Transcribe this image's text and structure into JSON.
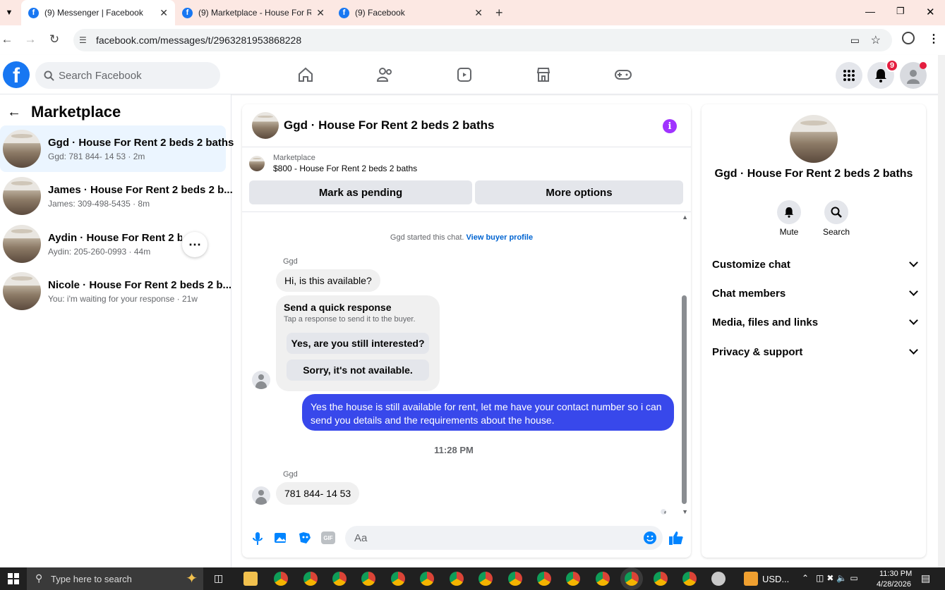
{
  "browser": {
    "tabs": [
      {
        "title": "(9) Messenger | Facebook"
      },
      {
        "title": "(9) Marketplace - House For Re"
      },
      {
        "title": "(9) Facebook"
      }
    ],
    "url": "facebook.com/messages/t/2963281953868228"
  },
  "header": {
    "search_placeholder": "Search Facebook",
    "notification_count": "9",
    "accent_color": "#1877f2"
  },
  "sidebar": {
    "title": "Marketplace",
    "conversations": [
      {
        "title": "Ggd · House For Rent 2 beds 2 baths",
        "preview": "Ggd: 781 844- 14 53 · 2m"
      },
      {
        "title": "James · House For Rent 2 beds 2 b...",
        "preview": "James: 309-498-5435 · 8m"
      },
      {
        "title": "Aydin · House For Rent 2 beds 2...",
        "preview": "Aydin: 205-260-0993 · 44m"
      },
      {
        "title": "Nicole · House For Rent 2 beds 2 b...",
        "preview": "You: i'm waiting for your response · 21w"
      }
    ]
  },
  "chat": {
    "title": "Ggd · House For Rent 2 beds 2 baths",
    "listing_source": "Marketplace",
    "listing": "$800 - House For Rent 2 beds 2 baths",
    "mark_pending": "Mark as pending",
    "more_options": "More options",
    "started_text": "Ggd started this chat.",
    "view_profile": "View buyer profile",
    "sender_name": "Ggd",
    "msg1": "Hi, is this available?",
    "quick_title": "Send a quick response",
    "quick_sub": "Tap a response to send it to the buyer.",
    "quick_opt1": "Yes, are you still interested?",
    "quick_opt2": "Sorry, it's not available.",
    "my_msg": "Yes the house is still available for rent, let me have your contact number so i can send you details and the requirements about the house.",
    "timestamp": "11:28 PM",
    "msg2": "781 844- 14 53",
    "composer_placeholder": "Aa",
    "my_bubble_color": "#3848eb"
  },
  "details": {
    "title": "Ggd · House For Rent 2 beds 2 baths",
    "mute": "Mute",
    "search": "Search",
    "sections": [
      "Customize chat",
      "Chat members",
      "Media, files and links",
      "Privacy & support"
    ]
  },
  "taskbar": {
    "search_placeholder": "Type here to search",
    "currency": "USD...",
    "time": "11:30 PM",
    "date": "4/28/2026"
  }
}
